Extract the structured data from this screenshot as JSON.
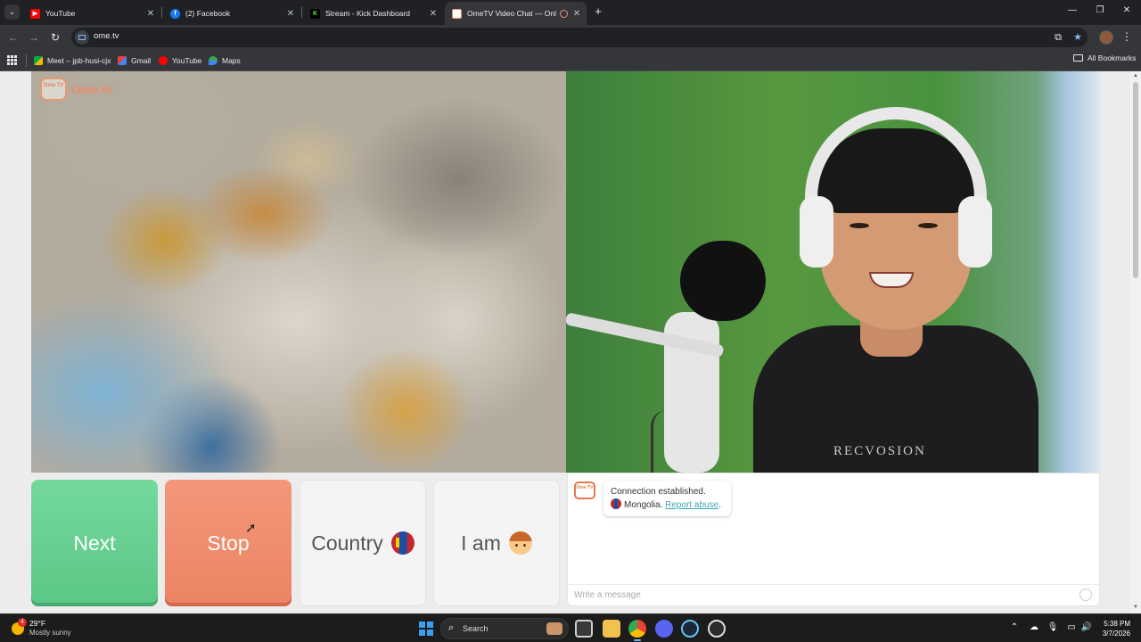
{
  "browser": {
    "tabs": [
      {
        "title": "YouTube",
        "favicon": "youtube-icon",
        "color": "#ff0000"
      },
      {
        "title": "(2) Facebook",
        "favicon": "facebook-icon",
        "color": "#1877f2"
      },
      {
        "title": "Stream - Kick Dashboard",
        "favicon": "kick-icon",
        "color": "#53fc18"
      },
      {
        "title": "OmeTV Video Chat — Onl",
        "favicon": "ometv-icon",
        "color": "#e8906a",
        "active": true
      }
    ],
    "url": "ome.tv",
    "bookmarks": [
      {
        "label": "Meet – jpb-husi-cjx",
        "favicon": "meet-icon"
      },
      {
        "label": "Gmail",
        "favicon": "gmail-icon"
      },
      {
        "label": "YouTube",
        "favicon": "youtube-icon"
      },
      {
        "label": "Maps",
        "favicon": "maps-icon"
      }
    ],
    "all_bookmarks": "All Bookmarks"
  },
  "ometv": {
    "logo_text": "Ome.tv",
    "logo_box": "Ome TV",
    "buttons": {
      "next": "Next",
      "stop": "Stop",
      "country": "Country",
      "iam": "I am"
    },
    "chat": {
      "status": "Connection established.",
      "country": "Mongolia.",
      "report": "Report abuse",
      "report_suffix": ".",
      "placeholder": "Write a message"
    },
    "shirt_text": "RECVOSION"
  },
  "taskbar": {
    "temperature": "29°F",
    "condition": "Mostly sunny",
    "weather_badge": "4",
    "search_label": "Search",
    "time": "5:38 PM",
    "date": "3/7/2026"
  },
  "colors": {
    "next_button": "#5cc787",
    "stop_button": "#ec8463",
    "accent": "#e8906a",
    "report_link": "#3fa6b5"
  }
}
